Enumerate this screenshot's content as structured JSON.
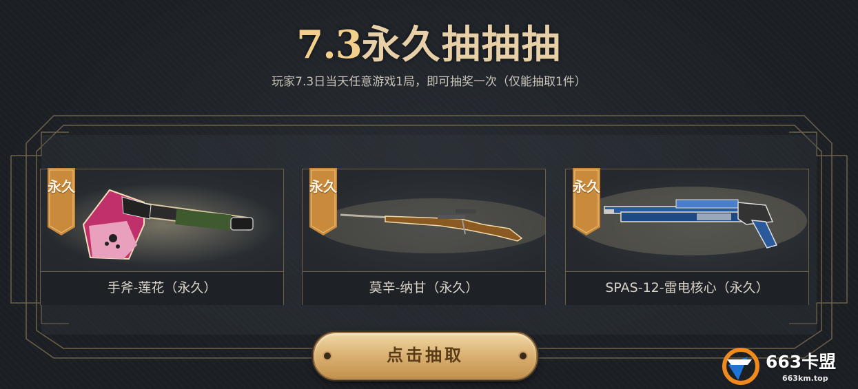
{
  "header": {
    "title_number": "7.3",
    "title_text": "永久抽抽抽",
    "subtitle": "玩家7.3日当天任意游戏1局，即可抽奖一次（仅能抽取1件）"
  },
  "prizes": [
    {
      "badge": "永久",
      "name": "手斧-莲花（永久）",
      "icon": "lotus-axe-icon"
    },
    {
      "badge": "永久",
      "name": "莫辛-纳甘（永久）",
      "icon": "mosin-nagant-rifle-icon"
    },
    {
      "badge": "永久",
      "name": "SPAS-12-雷电核心（永久）",
      "icon": "spas12-shotgun-icon"
    }
  ],
  "draw_button": {
    "label": "点击抽取"
  },
  "watermark": {
    "brand": "663卡盟",
    "url": "663km.top"
  },
  "colors": {
    "background": "#1b1f24",
    "gold": "#e2c08a",
    "badge": "#c98a3c",
    "button": "#d7ad6d"
  }
}
